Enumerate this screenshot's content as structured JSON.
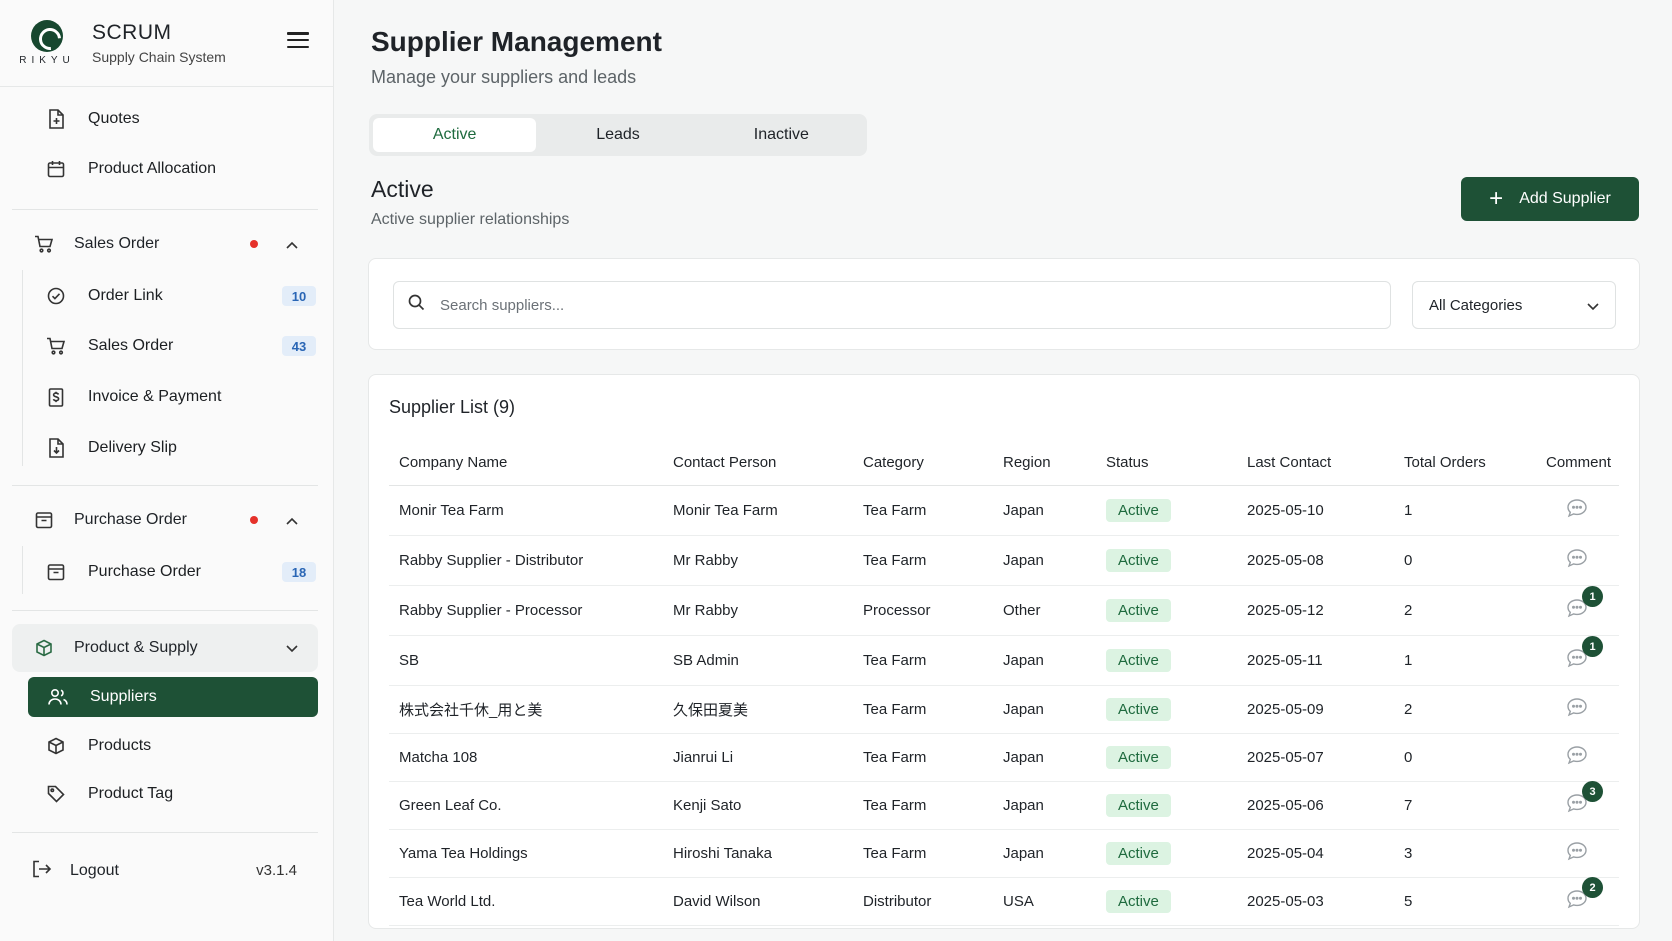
{
  "brand": {
    "title": "SCRUM",
    "subtitle": "Supply Chain System",
    "logo_text": "RIKYU"
  },
  "sidebar": {
    "top_items": [
      {
        "label": "Quotes",
        "icon": "file-plus-icon"
      },
      {
        "label": "Product Allocation",
        "icon": "calendar-icon"
      }
    ],
    "groups": {
      "sales_order": {
        "label": "Sales Order",
        "icon": "cart-icon",
        "alert": true,
        "expanded": true,
        "items": [
          {
            "label": "Order Link",
            "icon": "check-circle-icon",
            "count": "10"
          },
          {
            "label": "Sales Order",
            "icon": "cart-icon",
            "count": "43"
          },
          {
            "label": "Invoice & Payment",
            "icon": "dollar-doc-icon"
          },
          {
            "label": "Delivery Slip",
            "icon": "file-download-icon"
          }
        ]
      },
      "purchase_order": {
        "label": "Purchase Order",
        "icon": "archive-icon",
        "alert": true,
        "expanded": true,
        "items": [
          {
            "label": "Purchase Order",
            "icon": "archive-icon",
            "count": "18"
          }
        ]
      },
      "product_supply": {
        "label": "Product & Supply",
        "icon": "box-icon",
        "expanded": true,
        "items": [
          {
            "label": "Suppliers",
            "icon": "users-icon",
            "active": true
          },
          {
            "label": "Products",
            "icon": "box-icon"
          },
          {
            "label": "Product Tag",
            "icon": "tag-icon"
          }
        ]
      }
    },
    "logout": "Logout",
    "version": "v3.1.4"
  },
  "page": {
    "title": "Supplier Management",
    "subtitle": "Manage your suppliers and leads",
    "tabs": [
      {
        "label": "Active",
        "active": true
      },
      {
        "label": "Leads"
      },
      {
        "label": "Inactive"
      }
    ],
    "section_title": "Active",
    "section_subtitle": "Active supplier relationships",
    "add_button": "Add Supplier"
  },
  "filters": {
    "search_placeholder": "Search suppliers...",
    "category": "All Categories"
  },
  "table": {
    "title": "Supplier List (9)",
    "columns": [
      "Company Name",
      "Contact Person",
      "Category",
      "Region",
      "Status",
      "Last Contact",
      "Total Orders",
      "Comment"
    ],
    "rows": [
      {
        "company": "Monir Tea Farm",
        "contact": "Monir Tea Farm",
        "category": "Tea Farm",
        "region": "Japan",
        "status": "Active",
        "last_contact": "2025-05-10",
        "orders": "1",
        "comments": ""
      },
      {
        "company": "Rabby Supplier - Distributor",
        "contact": "Mr Rabby",
        "category": "Tea Farm",
        "region": "Japan",
        "status": "Active",
        "last_contact": "2025-05-08",
        "orders": "0",
        "comments": ""
      },
      {
        "company": "Rabby Supplier - Processor",
        "contact": "Mr Rabby",
        "category": "Processor",
        "region": "Other",
        "status": "Active",
        "last_contact": "2025-05-12",
        "orders": "2",
        "comments": "1"
      },
      {
        "company": "SB",
        "contact": "SB Admin",
        "category": "Tea Farm",
        "region": "Japan",
        "status": "Active",
        "last_contact": "2025-05-11",
        "orders": "1",
        "comments": "1"
      },
      {
        "company": "株式会社千休_用と美",
        "contact": "久保田夏美",
        "category": "Tea Farm",
        "region": "Japan",
        "status": "Active",
        "last_contact": "2025-05-09",
        "orders": "2",
        "comments": ""
      },
      {
        "company": "Matcha 108",
        "contact": "Jianrui Li",
        "category": "Tea Farm",
        "region": "Japan",
        "status": "Active",
        "last_contact": "2025-05-07",
        "orders": "0",
        "comments": ""
      },
      {
        "company": "Green Leaf Co.",
        "contact": "Kenji Sato",
        "category": "Tea Farm",
        "region": "Japan",
        "status": "Active",
        "last_contact": "2025-05-06",
        "orders": "7",
        "comments": "3"
      },
      {
        "company": "Yama Tea Holdings",
        "contact": "Hiroshi Tanaka",
        "category": "Tea Farm",
        "region": "Japan",
        "status": "Active",
        "last_contact": "2025-05-04",
        "orders": "3",
        "comments": ""
      },
      {
        "company": "Tea World Ltd.",
        "contact": "David Wilson",
        "category": "Distributor",
        "region": "USA",
        "status": "Active",
        "last_contact": "2025-05-03",
        "orders": "5",
        "comments": "2"
      }
    ]
  },
  "colors": {
    "brand_green": "#1e5136",
    "status_bg": "#dcf3e2",
    "alert_red": "#e5312a",
    "badge_blue": "#2a66b5"
  }
}
